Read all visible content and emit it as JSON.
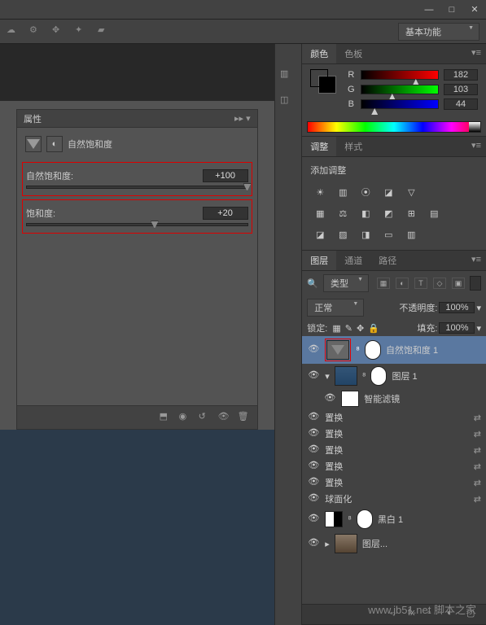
{
  "titlebar": {
    "minimize": "—",
    "maximize": "□",
    "close": "✕"
  },
  "workspace_dropdown": "基本功能",
  "properties": {
    "title": "属性",
    "adjustment_name": "自然饱和度",
    "vibrance": {
      "label": "自然饱和度:",
      "value": "+100",
      "pos": 100
    },
    "saturation": {
      "label": "饱和度:",
      "value": "+20",
      "pos": 58
    }
  },
  "color_panel": {
    "tabs": [
      "颜色",
      "色板"
    ],
    "fg_color": "#b67833",
    "r": {
      "label": "R",
      "value": "182",
      "pos": 71
    },
    "g": {
      "label": "G",
      "value": "103",
      "pos": 40
    },
    "b": {
      "label": "B",
      "value": "44",
      "pos": 17
    }
  },
  "adjustments_panel": {
    "tabs": [
      "调整",
      "样式"
    ],
    "add_label": "添加调整"
  },
  "layers_panel": {
    "tabs": [
      "图层",
      "通道",
      "路径"
    ],
    "filter_label": "类型",
    "blend_mode": "正常",
    "opacity_label": "不透明度:",
    "opacity_value": "100%",
    "lock_label": "锁定:",
    "fill_label": "填充:",
    "fill_value": "100%",
    "layers": [
      {
        "name": "自然饱和度 1",
        "selected": true,
        "type": "adj"
      },
      {
        "name": "图层 1",
        "type": "smart"
      },
      {
        "name": "智能滤镜",
        "type": "filters_header"
      },
      {
        "name": "置换",
        "type": "filter"
      },
      {
        "name": "置换",
        "type": "filter"
      },
      {
        "name": "置换",
        "type": "filter"
      },
      {
        "name": "置换",
        "type": "filter"
      },
      {
        "name": "置换",
        "type": "filter"
      },
      {
        "name": "球面化",
        "type": "filter"
      },
      {
        "name": "黑白 1",
        "type": "adj2"
      },
      {
        "name": "图层...",
        "type": "img"
      }
    ]
  },
  "watermark": "www.jb51.net 脚本之家"
}
